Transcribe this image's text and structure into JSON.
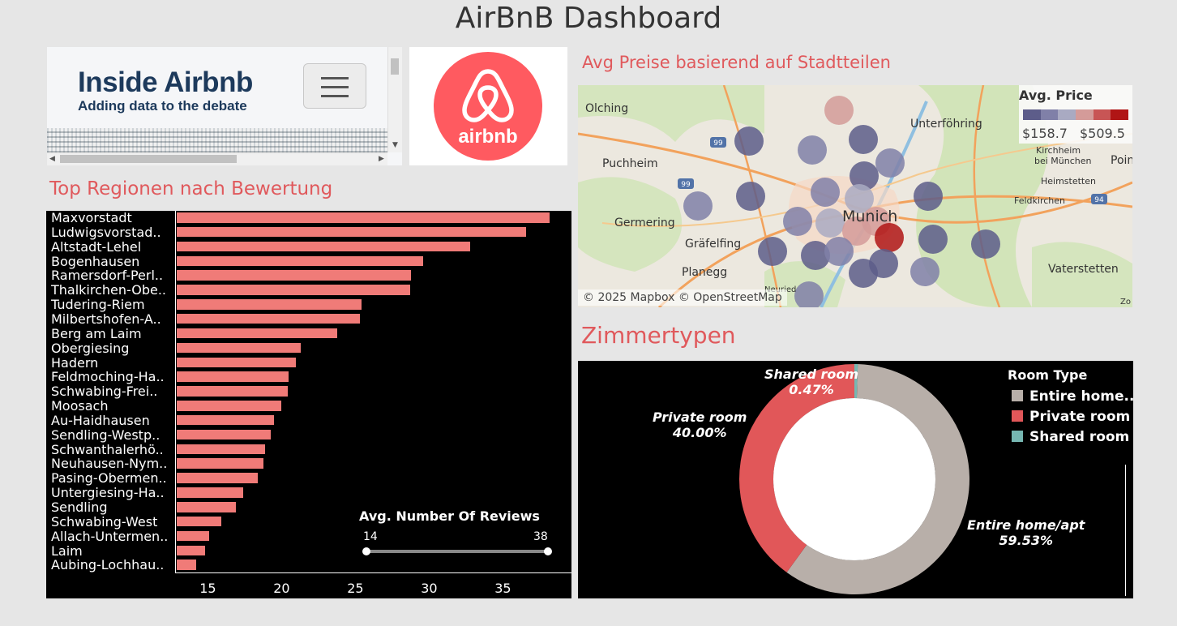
{
  "dashboard": {
    "title": "AirBnB Dashboard"
  },
  "web_embed": {
    "brand": "Inside Airbnb",
    "tagline": "Adding data to the debate"
  },
  "logo": {
    "text": "airbnb",
    "color": "#ff5a60"
  },
  "sections": {
    "bar_title": "Top Regionen nach Bewertung",
    "map_title": "Avg Preise basierend auf Stadtteilen",
    "donut_title": "Zimmertypen"
  },
  "chart_data": [
    {
      "type": "bar",
      "orientation": "horizontal",
      "title": "Top Regionen nach Bewertung",
      "categories": [
        "Maxvorstadt",
        "Ludwigsvorstad..",
        "Altstadt-Lehel",
        "Bogenhausen",
        "Ramersdorf-Perl..",
        "Thalkirchen-Obe..",
        "Tudering-Riem",
        "Milbertshofen-A..",
        "Berg am Laim",
        "Obergiesing",
        "Hadern",
        "Feldmoching-Ha..",
        "Schwabing-Frei..",
        "Moosach",
        "Au-Haidhausen",
        "Sendling-Westp..",
        "Schwanthalerhö..",
        "Neuhausen-Nym..",
        "Pasing-Obermen..",
        "Untergiesing-Ha..",
        "Sendling",
        "Schwabing-West",
        "Allach-Untermen..",
        "Laim",
        "Aubing-Lochhau.."
      ],
      "values": [
        38.2,
        36.6,
        32.8,
        29.6,
        28.8,
        28.7,
        25.4,
        25.3,
        23.8,
        21.3,
        21.0,
        20.5,
        20.4,
        20.0,
        19.5,
        19.3,
        18.9,
        18.8,
        18.4,
        17.4,
        16.9,
        15.9,
        15.1,
        14.8,
        14.2
      ],
      "xlim": [
        12.9,
        38.9
      ],
      "xticks": [
        15,
        20,
        25,
        30,
        35
      ],
      "color": "#f07b78",
      "grid": false
    },
    {
      "type": "pie",
      "title": "Zimmertypen",
      "legend_title": "Room Type",
      "legend_position": "top-right",
      "slices": [
        {
          "name": "Entire home/apt",
          "legend": "Entire home..",
          "value": 59.53,
          "label": "59.53%",
          "color": "#b8afa9"
        },
        {
          "name": "Private room",
          "legend": "Private room",
          "value": 40.0,
          "label": "40.00%",
          "color": "#e15759"
        },
        {
          "name": "Shared room",
          "legend": "Shared room",
          "value": 0.47,
          "label": "0.47%",
          "color": "#76b7b2"
        }
      ]
    }
  ],
  "slider": {
    "title": "Avg. Number Of Reviews",
    "min": "14",
    "max": "38"
  },
  "map": {
    "legend_title": "Avg. Price",
    "legend_min": "$158.7",
    "legend_max": "$509.5",
    "legend_colors": [
      "#5d5d8a",
      "#8080a8",
      "#a9aac2",
      "#d49b99",
      "#c85555",
      "#b01515"
    ],
    "attribution": "© 2025 Mapbox © OpenStreetMap",
    "places": [
      "Olching",
      "Unterföhring",
      "Puchheim",
      "Kirchheim",
      "bei München",
      "Poin",
      "Heimstetten",
      "Feldkirchen",
      "Germering",
      "Munich",
      "Gräfelfing",
      "Planegg",
      "Vaterstetten",
      "Neuried",
      "Zo"
    ],
    "roads": [
      "99",
      "99",
      "94"
    ]
  }
}
